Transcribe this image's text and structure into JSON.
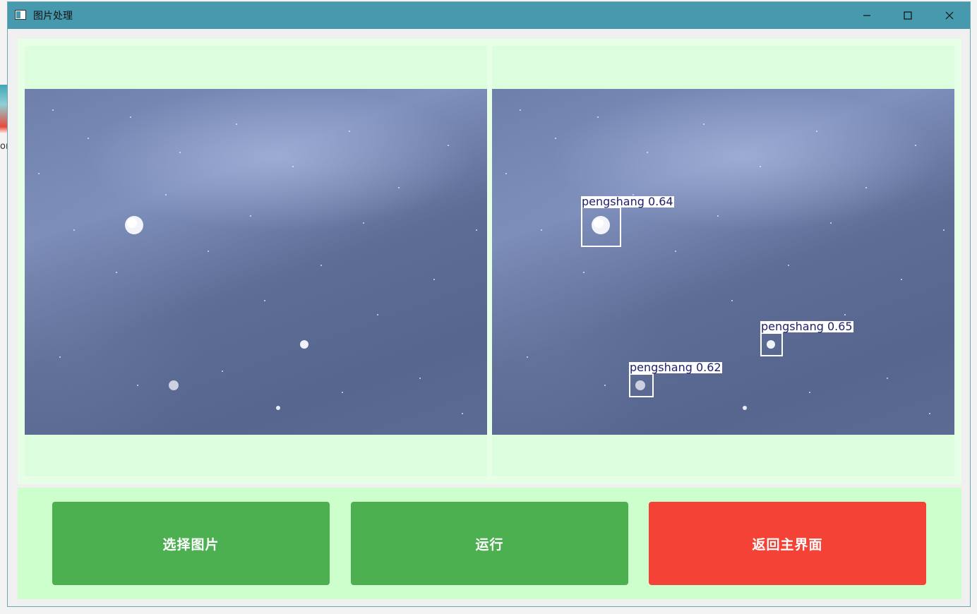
{
  "window": {
    "title": "图片处理",
    "controls": {
      "minimize": "minimize-icon",
      "maximize": "maximize-icon",
      "close": "close-icon"
    }
  },
  "desktop": {
    "edge_text": "or"
  },
  "images": {
    "original": {
      "label": "original-image"
    },
    "result": {
      "detections": [
        {
          "label": "pengshang 0.64"
        },
        {
          "label": "pengshang 0.65"
        },
        {
          "label": "pengshang 0.62"
        }
      ]
    }
  },
  "buttons": {
    "select": "选择图片",
    "run": "运行",
    "back": "返回主界面"
  },
  "colors": {
    "titlebar": "#4799ae",
    "panel": "#e8ffe7",
    "button_panel": "#ccffcc",
    "green_button": "#4caf50",
    "red_button": "#f44336"
  }
}
